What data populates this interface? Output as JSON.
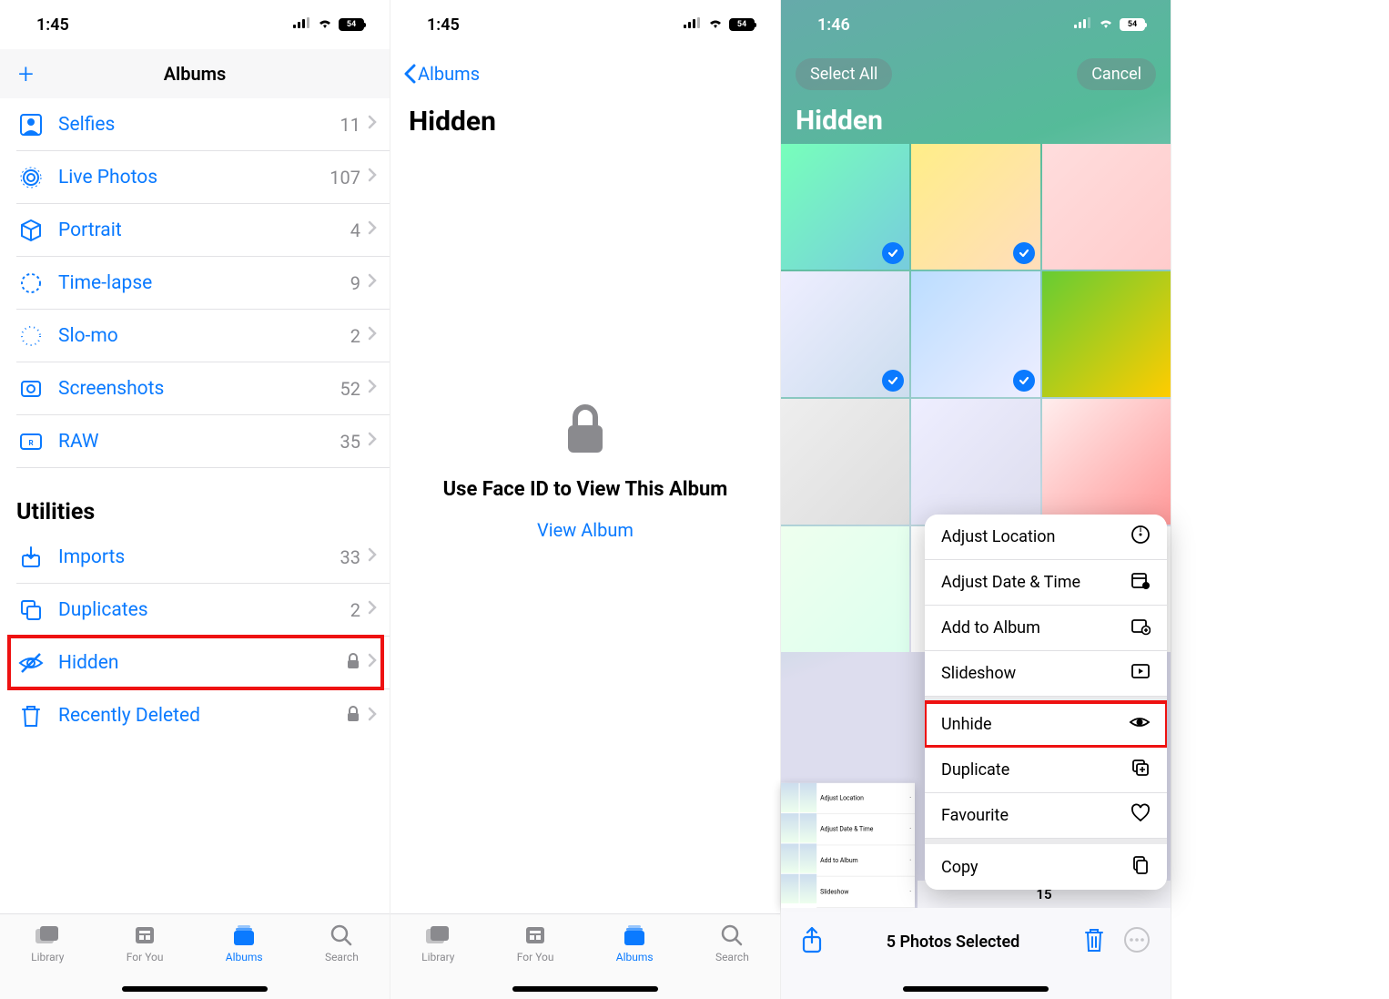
{
  "screen1": {
    "time": "1:45",
    "battery": "54",
    "nav_title": "Albums",
    "section_utilities": "Utilities",
    "rows_media": [
      {
        "id": "selfies",
        "label": "Selfies",
        "count": "11"
      },
      {
        "id": "livephotos",
        "label": "Live Photos",
        "count": "107"
      },
      {
        "id": "portrait",
        "label": "Portrait",
        "count": "4"
      },
      {
        "id": "timelapse",
        "label": "Time-lapse",
        "count": "9"
      },
      {
        "id": "slomo",
        "label": "Slo-mo",
        "count": "2"
      },
      {
        "id": "screenshots",
        "label": "Screenshots",
        "count": "52"
      },
      {
        "id": "raw",
        "label": "RAW",
        "count": "35"
      }
    ],
    "rows_util": [
      {
        "id": "imports",
        "label": "Imports",
        "count": "33",
        "lock": false
      },
      {
        "id": "duplicates",
        "label": "Duplicates",
        "count": "2",
        "lock": false
      },
      {
        "id": "hidden",
        "label": "Hidden",
        "count": "",
        "lock": true,
        "highlighted": true
      },
      {
        "id": "recentlydeleted",
        "label": "Recently Deleted",
        "count": "",
        "lock": true
      }
    ],
    "tabs": [
      "Library",
      "For You",
      "Albums",
      "Search"
    ],
    "active_tab": 2
  },
  "screen2": {
    "time": "1:45",
    "battery": "54",
    "back_label": "Albums",
    "title": "Hidden",
    "faceid_msg": "Use Face ID to View This Album",
    "view_link": "View Album",
    "tabs": [
      "Library",
      "For You",
      "Albums",
      "Search"
    ],
    "active_tab": 2
  },
  "screen3": {
    "time": "1:46",
    "battery": "54",
    "select_all": "Select All",
    "cancel": "Cancel",
    "title": "Hidden",
    "selected_count_label": "5 Photos Selected",
    "timestamp_prefix": "15",
    "menu": [
      {
        "id": "adjloc",
        "label": "Adjust Location"
      },
      {
        "id": "adjdt",
        "label": "Adjust Date & Time"
      },
      {
        "id": "addalbum",
        "label": "Add to Album"
      },
      {
        "id": "slideshow",
        "label": "Slideshow"
      },
      {
        "id": "unhide",
        "label": "Unhide",
        "highlighted": true
      },
      {
        "id": "duplicate",
        "label": "Duplicate"
      },
      {
        "id": "favourite",
        "label": "Favourite"
      },
      {
        "id": "copy",
        "label": "Copy"
      }
    ],
    "mini_menu": [
      "Adjust Location",
      "Adjust Date & Time",
      "Add to Album",
      "Slideshow"
    ],
    "grid_cells": [
      {
        "sel": true,
        "c1": "#7fb",
        "c2": "#7cd"
      },
      {
        "sel": true,
        "c1": "#fe8",
        "c2": "#fdb"
      },
      {
        "sel": false,
        "c1": "#fdd",
        "c2": "#fcc"
      },
      {
        "sel": true,
        "c1": "#eef",
        "c2": "#cde"
      },
      {
        "sel": true,
        "c1": "#bdf",
        "c2": "#eef"
      },
      {
        "sel": false,
        "c1": "#6c3",
        "c2": "#fc0"
      },
      {
        "sel": false,
        "c1": "#eee",
        "c2": "#ddd"
      },
      {
        "sel": false,
        "c1": "#eef",
        "c2": "#dde"
      },
      {
        "sel": false,
        "c1": "#fee",
        "c2": "#f99"
      },
      {
        "sel": false,
        "c1": "#efe",
        "c2": "#dfe"
      },
      {
        "sel": false,
        "c1": "#fff",
        "c2": "#fff"
      },
      {
        "sel": false,
        "c1": "#fff",
        "c2": "#fff"
      }
    ]
  }
}
